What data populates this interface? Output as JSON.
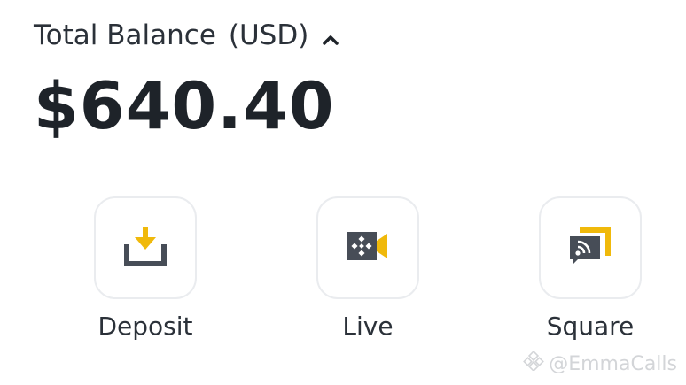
{
  "balance": {
    "label": "Total Balance",
    "currency": "(USD)",
    "toggle_icon": "chevron-up-icon",
    "amount": "$640.40"
  },
  "actions": [
    {
      "label": "Deposit",
      "icon": "deposit-icon"
    },
    {
      "label": "Live",
      "icon": "live-video-icon"
    },
    {
      "label": "Square",
      "icon": "square-feed-icon"
    }
  ],
  "watermark": {
    "text": "@EmmaCalls",
    "icon": "binance-logo-icon"
  },
  "colors": {
    "accent": "#f0b90b",
    "icon_dark": "#474d57",
    "text": "#1e2329",
    "tile_border": "#eaecef"
  }
}
